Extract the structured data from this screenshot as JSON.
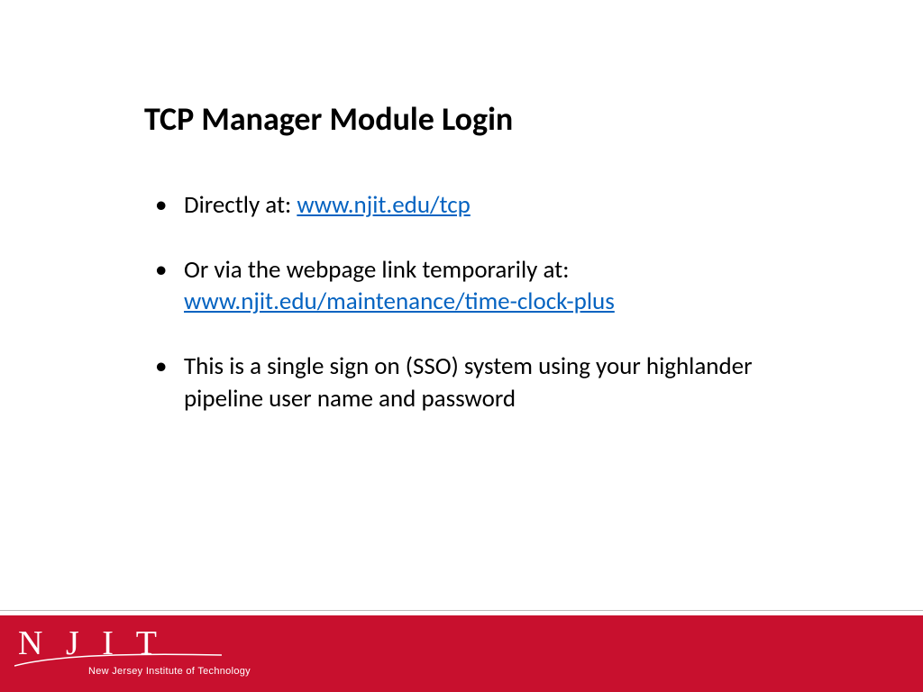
{
  "title": "TCP Manager Module Login",
  "bullets": [
    {
      "text_before": "Directly at:  ",
      "link": "www.njit.edu/tcp",
      "text_after": ""
    },
    {
      "text_before": "Or via the webpage link temporarily at: ",
      "link": "www.njit.edu/maintenance/time-clock-plus",
      "text_after": "",
      "link_on_newline": true
    },
    {
      "text_before": "This is a single sign on (SSO) system using your highlander pipeline user name and password",
      "link": "",
      "text_after": ""
    }
  ],
  "footer": {
    "logo_text": "N J I T",
    "tagline": "New Jersey Institute of Technology",
    "bg_color": "#C8102E"
  }
}
